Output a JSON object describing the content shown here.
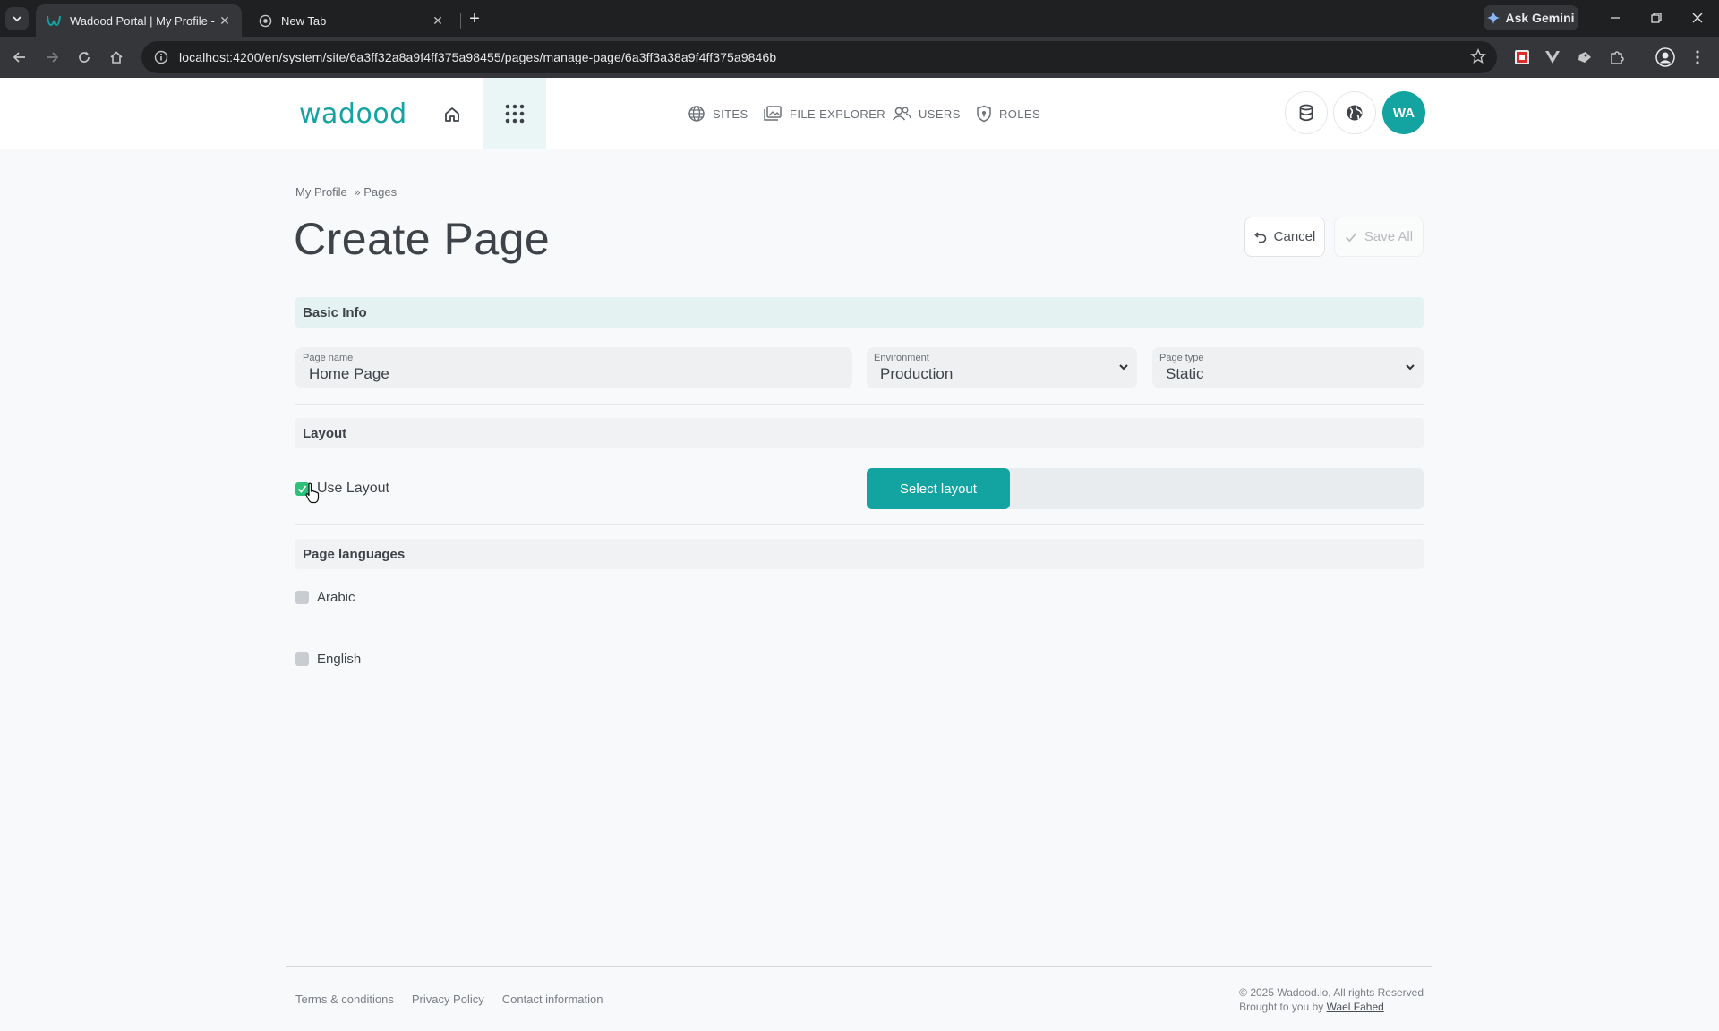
{
  "browser": {
    "tabs": [
      {
        "title": "Wadood Portal | My Profile - Cr",
        "active": true
      },
      {
        "title": "New Tab",
        "active": false
      }
    ],
    "url": "localhost:4200/en/system/site/6a3ff32a8a9f4ff375a98455/pages/manage-page/6a3ff3a38a9f4ff375a9846b",
    "gemini_label": "Ask Gemini"
  },
  "header": {
    "logo": "wadood",
    "nav": [
      {
        "label": "SITES",
        "icon": "globe-icon"
      },
      {
        "label": "FILE EXPLORER",
        "icon": "folder-images-icon"
      },
      {
        "label": "USERS",
        "icon": "users-icon"
      },
      {
        "label": "ROLES",
        "icon": "shield-icon"
      }
    ],
    "avatar_initials": "WA"
  },
  "breadcrumb": [
    "My Profile",
    "» Pages"
  ],
  "page_title": "Create Page",
  "actions": {
    "cancel": "Cancel",
    "save_all": "Save All"
  },
  "basic_info": {
    "title": "Basic Info",
    "page_name": {
      "label": "Page name",
      "value": "Home Page"
    },
    "environment": {
      "label": "Environment",
      "value": "Production"
    },
    "page_type": {
      "label": "Page type",
      "value": "Static"
    }
  },
  "layout": {
    "title": "Layout",
    "use_layout_label": "Use Layout",
    "use_layout_checked": true,
    "select_layout_button": "Select layout"
  },
  "languages": {
    "title": "Page languages",
    "items": [
      {
        "label": "Arabic",
        "checked": false
      },
      {
        "label": "English",
        "checked": false
      }
    ]
  },
  "footer": {
    "links": [
      "Terms & conditions",
      "Privacy Policy",
      "Contact information"
    ],
    "copyright": "© 2025 Wadood.io, All rights Reserved",
    "credit_prefix": "Brought to you by",
    "credit_name": "Wael Fahed"
  },
  "colors": {
    "accent": "#13a3a0",
    "checkbox_on": "#2ec07a"
  }
}
